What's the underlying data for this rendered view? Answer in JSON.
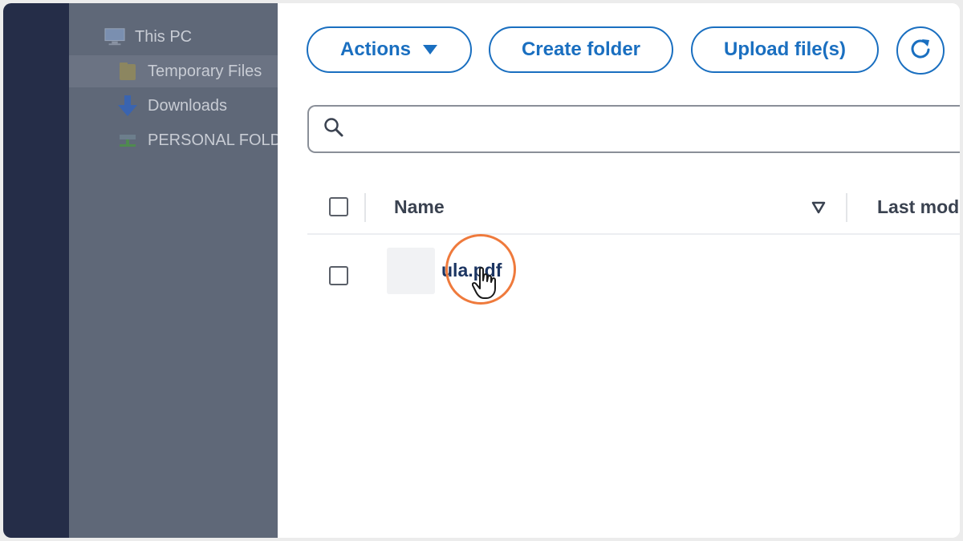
{
  "sidebar": {
    "items": [
      {
        "label": "This PC",
        "icon": "monitor-icon"
      },
      {
        "label": "Temporary Files",
        "icon": "folder-icon",
        "selected": true
      },
      {
        "label": "Downloads",
        "icon": "download-arrow-icon"
      },
      {
        "label": "PERSONAL FOLD",
        "icon": "network-drive-icon"
      }
    ]
  },
  "toolbar": {
    "actions_label": "Actions",
    "create_folder_label": "Create folder",
    "upload_label": "Upload file(s)",
    "refresh_icon": "refresh-icon"
  },
  "search": {
    "placeholder": "",
    "value": ""
  },
  "table": {
    "columns": [
      {
        "label": "Name",
        "sort": "descending"
      },
      {
        "label": "Last mod"
      }
    ],
    "rows": [
      {
        "name": "ula.pdf"
      }
    ]
  },
  "colors": {
    "accent": "#1a6fc0",
    "click_highlight": "#ef7a3c",
    "overlay_dark": "#252d48",
    "overlay_gray": "#5f6878"
  }
}
